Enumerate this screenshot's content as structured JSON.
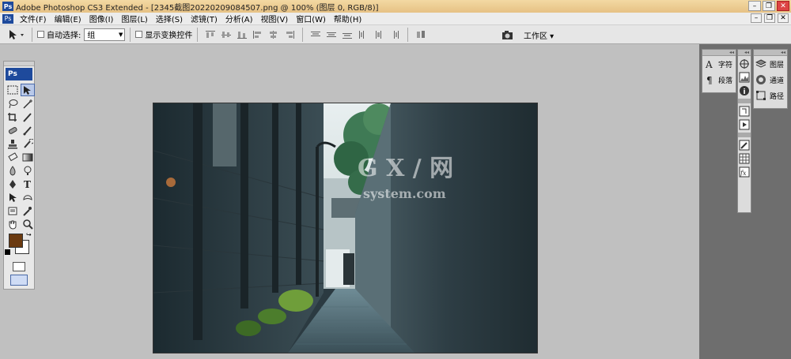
{
  "window": {
    "app_icon": "Ps",
    "title": "Adobe Photoshop CS3 Extended - [2345截图20220209084507.png @ 100% (图层 0, RGB/8)]",
    "buttons": [
      "minimize",
      "restore",
      "close"
    ]
  },
  "menubar": {
    "ps_icon": "Ps",
    "items": [
      "文件(F)",
      "编辑(E)",
      "图像(I)",
      "图层(L)",
      "选择(S)",
      "滤镜(T)",
      "分析(A)",
      "视图(V)",
      "窗口(W)",
      "帮助(H)"
    ]
  },
  "options_bar": {
    "auto_select_label": "自动选择:",
    "auto_select_value": "组",
    "show_transform_label": "显示变换控件",
    "workspace_label": "工作区 ▾"
  },
  "toolbox": {
    "ps_label": "Ps",
    "foreground_color": "#6b3a10",
    "background_color": "#ffffff"
  },
  "panels": {
    "col1": [
      {
        "icon": "type-icon",
        "label": "字符"
      },
      {
        "icon": "paragraph-icon",
        "label": "段落"
      }
    ],
    "col3": [
      {
        "icon": "layers-icon",
        "label": "图层"
      },
      {
        "icon": "channels-icon",
        "label": "通道"
      },
      {
        "icon": "paths-icon",
        "label": "路径"
      }
    ]
  },
  "canvas": {
    "watermark_main": "G X / 网",
    "watermark_sub": "system.com"
  }
}
